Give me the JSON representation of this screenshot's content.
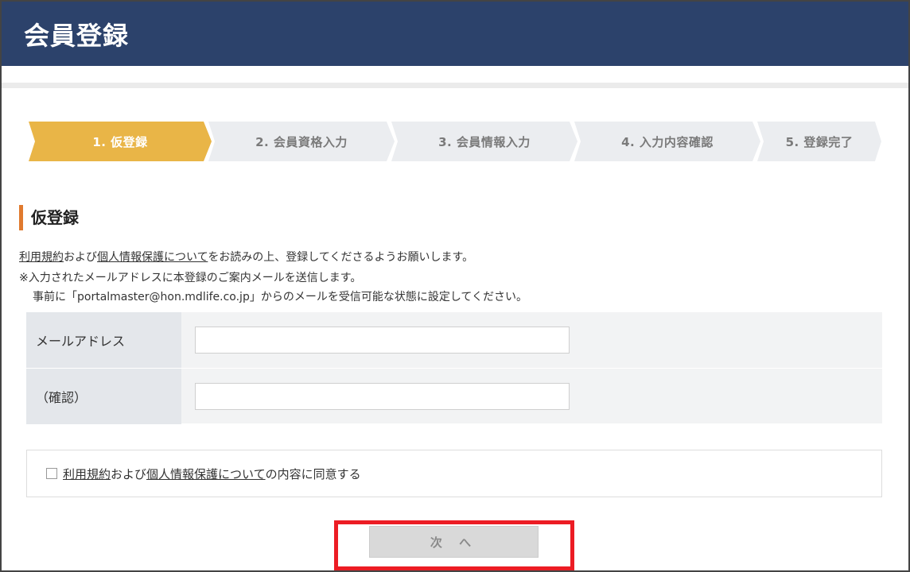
{
  "header": {
    "title": "会員登録"
  },
  "steps": [
    {
      "label": "1. 仮登録",
      "active": true
    },
    {
      "label": "2. 会員資格入力",
      "active": false
    },
    {
      "label": "3. 会員情報入力",
      "active": false
    },
    {
      "label": "4. 入力内容確認",
      "active": false
    },
    {
      "label": "5. 登録完了",
      "active": false
    }
  ],
  "colors": {
    "header_bg": "#2c426b",
    "step_active": "#e9b547",
    "step_inactive": "#ebedf0",
    "accent_bar": "#e07a2e",
    "highlight": "#ec1c24"
  },
  "section": {
    "title": "仮登録"
  },
  "notice": {
    "line1_link1": "利用規約",
    "line1_text1": "および",
    "line1_link2": "個人情報保護について",
    "line1_text2": "をお読みの上、登録してくださるようお願いします。",
    "line2": "※入力されたメールアドレスに本登録のご案内メールを送信します。",
    "line3": "事前に「portalmaster@hon.mdlife.co.jp」からのメールを受信可能な状態に設定してください。"
  },
  "form": {
    "email_label": "メールアドレス",
    "email_value": "",
    "confirm_label": "（確認）",
    "confirm_value": ""
  },
  "agree": {
    "link1": "利用規約",
    "text1": "および",
    "link2": "個人情報保護について",
    "text2": "の内容に同意する"
  },
  "next_button": {
    "label": "次 へ"
  }
}
